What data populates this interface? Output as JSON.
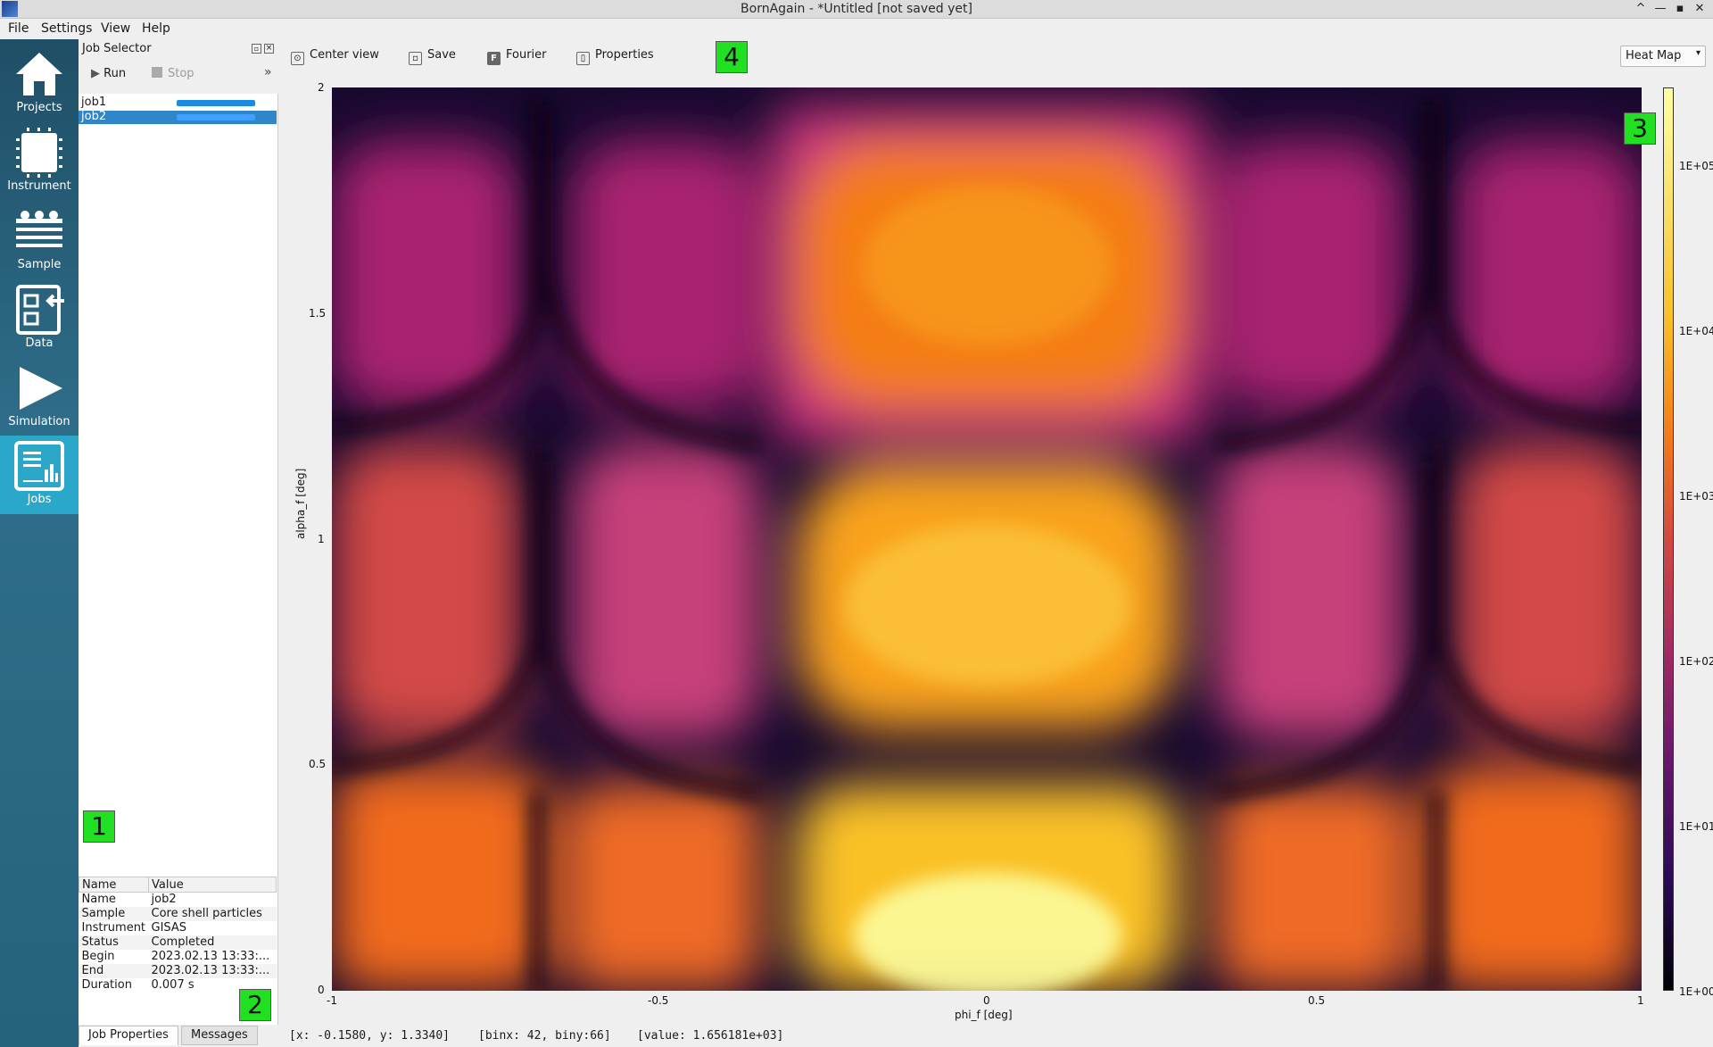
{
  "window": {
    "title": "BornAgain - *Untitled [not saved yet]",
    "controls": [
      "^",
      "—",
      "▪",
      "✕"
    ]
  },
  "menu": [
    "File",
    "Settings",
    "View",
    "Help"
  ],
  "sidebar": {
    "items": [
      {
        "label": "Projects",
        "icon": "home-icon"
      },
      {
        "label": "Instrument",
        "icon": "chip-icon"
      },
      {
        "label": "Sample",
        "icon": "layers-icon"
      },
      {
        "label": "Data",
        "icon": "data-import-icon"
      },
      {
        "label": "Simulation",
        "icon": "play-icon"
      },
      {
        "label": "Jobs",
        "icon": "chart-icon",
        "active": true
      }
    ]
  },
  "job_selector": {
    "title": "Job Selector",
    "run_label": "Run",
    "stop_label": "Stop",
    "more_label": "»",
    "jobs": [
      {
        "name": "job1",
        "progress": 1.0
      },
      {
        "name": "job2",
        "progress": 1.0,
        "selected": true
      }
    ]
  },
  "job_properties": {
    "headers": [
      "Name",
      "Value"
    ],
    "rows": [
      [
        "Name",
        "job2"
      ],
      [
        "Sample",
        "Core shell particles"
      ],
      [
        "Instrument",
        "GISAS"
      ],
      [
        "Status",
        "Completed"
      ],
      [
        "Begin",
        "2023.02.13 13:33:..."
      ],
      [
        "End",
        "2023.02.13 13:33:..."
      ],
      [
        "Duration",
        "0.007 s"
      ]
    ]
  },
  "tabs": [
    "Job Properties",
    "Messages"
  ],
  "markers": [
    "1",
    "2",
    "3",
    "4"
  ],
  "plot_toolbar": {
    "center_view": "Center view",
    "save": "Save",
    "fourier": "Fourier",
    "fourier_glyph": "F",
    "properties": "Properties",
    "view_mode": "Heat Map",
    "view_chevron": "▾"
  },
  "plot": {
    "x_axis": {
      "label": "phi_f [deg]",
      "ticks": [
        "-1",
        "-0.5",
        "0",
        "0.5",
        "1"
      ],
      "range": [
        -1,
        1
      ]
    },
    "y_axis": {
      "label": "alpha_f [deg]",
      "ticks": [
        "0",
        "0.5",
        "1",
        "1.5",
        "2"
      ],
      "range": [
        0,
        2
      ]
    },
    "colorbar_ticks": [
      "1E+00",
      "1E+01",
      "1E+02",
      "1E+03",
      "1E+04",
      "1E+05"
    ],
    "colormap": "inferno"
  },
  "status": {
    "coords": "[x: -0.1580, y: 1.3340]",
    "bins": "[binx: 42, biny:66]",
    "value": "[value: 1.656181e+03]"
  }
}
